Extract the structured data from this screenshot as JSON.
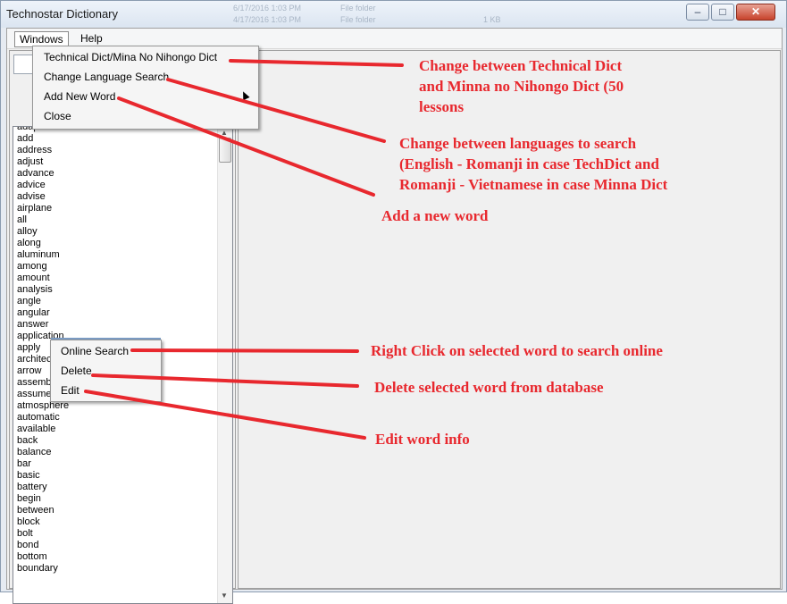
{
  "window": {
    "title": "Technostar Dictionary",
    "ghost_text": [
      "6/17/2016 1:03 PM",
      "File folder",
      "4/17/2016 1:03 PM",
      "File folder",
      "1 KB"
    ],
    "buttons": {
      "minimize": "–",
      "maximize": "□",
      "close": "✕"
    }
  },
  "menubar": {
    "windows": "Windows",
    "help": "Help"
  },
  "windows_menu": {
    "items": [
      "Technical Dict/Mina No Nihongo Dict",
      "Change Language Search",
      "Add New Word",
      "Close"
    ]
  },
  "word_list": {
    "words": [
      "adapter",
      "add",
      "address",
      "adjust",
      "advance",
      "advice",
      "advise",
      "airplane",
      "all",
      "alloy",
      "along",
      "aluminum",
      "among",
      "amount",
      "analysis",
      "angle",
      "angular",
      "answer",
      "application",
      "apply",
      "architecture",
      "arrow",
      "assembly",
      "assume",
      "atmosphere",
      "automatic",
      "available",
      "back",
      "balance",
      "bar",
      "basic",
      "battery",
      "begin",
      "between",
      "block",
      "bolt",
      "bond",
      "bottom",
      "boundary"
    ],
    "selected": "application"
  },
  "context_menu": {
    "items": [
      "Online Search",
      "Delete",
      "Edit"
    ]
  },
  "annotations": {
    "menu_dict": [
      "Change between Technical Dict",
      "and Minna no Nihongo Dict (50",
      "lessons"
    ],
    "menu_lang": [
      "Change between languages to search",
      "(English - Romanji in case TechDict and",
      "Romanji - Vietnamese in case Minna Dict"
    ],
    "menu_add": [
      "Add a new word"
    ],
    "ctx_online": [
      "Right Click on selected word to search online"
    ],
    "ctx_delete": [
      "Delete selected word from database"
    ],
    "ctx_edit": [
      "Edit word info"
    ]
  },
  "colors": {
    "annotation": "#e8282e",
    "menu_highlight": "#7a9ac2"
  }
}
